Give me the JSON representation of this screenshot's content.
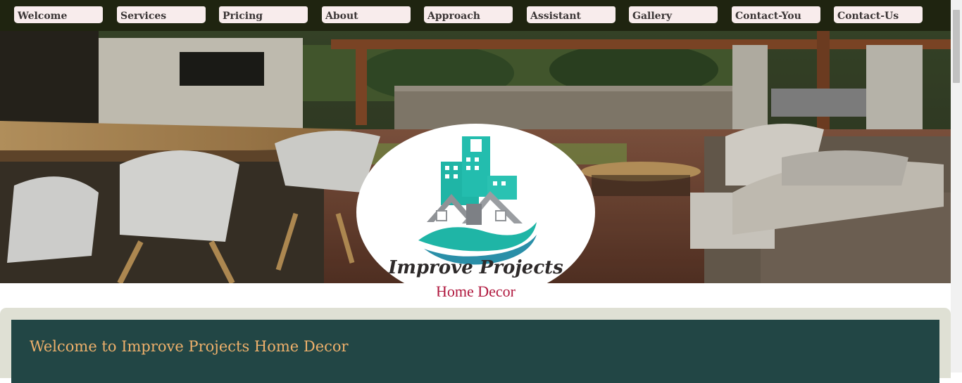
{
  "nav": {
    "items": [
      {
        "label": "Welcome"
      },
      {
        "label": "Services"
      },
      {
        "label": "Pricing"
      },
      {
        "label": "About"
      },
      {
        "label": "Approach"
      },
      {
        "label": "Assistant"
      },
      {
        "label": "Gallery"
      },
      {
        "label": "Contact-You"
      },
      {
        "label": "Contact-Us"
      }
    ]
  },
  "logo": {
    "title": "Improve Projects",
    "subtitle": "Home Decor",
    "icon": "buildings-house-waves-logo"
  },
  "welcome": {
    "title": "Welcome to Improve Projects Home Decor"
  },
  "colors": {
    "nav_bg": "#1f2410",
    "nav_button": "#f8ecec",
    "panel_bg": "#dfe0d4",
    "welcome_bg": "#224645",
    "welcome_text": "#eeb06b",
    "logo_teal": "#1fb5a6",
    "logo_red": "#b0183e"
  }
}
